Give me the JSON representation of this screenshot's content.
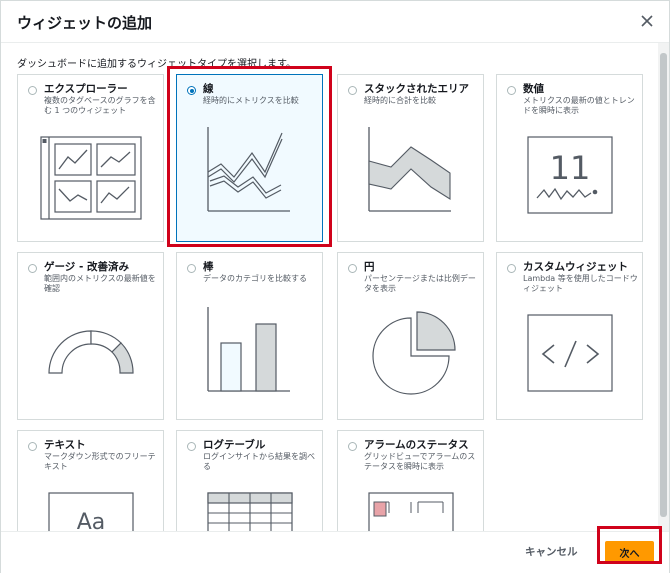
{
  "dialog": {
    "title": "ウィジェットの追加",
    "intro": "ダッシュボードに追加するウィジェットタイプを選択します。"
  },
  "cards": [
    {
      "title": "エクスプローラー",
      "desc": "複数のタグベースのグラフを含む 1 つのウィジェット",
      "selected": false,
      "icon": "explorer-icon"
    },
    {
      "title": "線",
      "desc": "経時的にメトリクスを比較",
      "selected": true,
      "icon": "line-chart-icon"
    },
    {
      "title": "スタックされたエリア",
      "desc": "経時的に合計を比較",
      "selected": false,
      "icon": "stacked-area-icon"
    },
    {
      "title": "数値",
      "desc": "メトリクスの最新の値とトレンドを瞬時に表示",
      "selected": false,
      "icon": "number-icon"
    },
    {
      "title": "ゲージ - 改善済み",
      "desc": "範囲内のメトリクスの最新値を確認",
      "selected": false,
      "icon": "gauge-icon"
    },
    {
      "title": "棒",
      "desc": "データのカテゴリを比較する",
      "selected": false,
      "icon": "bar-chart-icon"
    },
    {
      "title": "円",
      "desc": "パーセンテージまたは比例データを表示",
      "selected": false,
      "icon": "pie-chart-icon"
    },
    {
      "title": "カスタムウィジェット",
      "desc": "Lambda 等を使用したコードウィジェット",
      "selected": false,
      "icon": "code-icon"
    },
    {
      "title": "テキスト",
      "desc": "マークダウン形式でのフリーテキスト",
      "selected": false,
      "icon": "text-icon"
    },
    {
      "title": "ログテーブル",
      "desc": "ログインサイトから結果を調べる",
      "selected": false,
      "icon": "log-table-icon"
    },
    {
      "title": "アラームのステータス",
      "desc": "グリッドビューでアラームのステータスを瞬時に表示",
      "selected": false,
      "icon": "alarm-status-icon"
    }
  ],
  "number_illustration": "11",
  "text_illustration": "Aa",
  "footer": {
    "cancel_label": "キャンセル",
    "next_label": "次へ"
  },
  "colors": {
    "accent": "#0073bb",
    "primary_button": "#ff9900",
    "highlight": "#d0021b"
  }
}
